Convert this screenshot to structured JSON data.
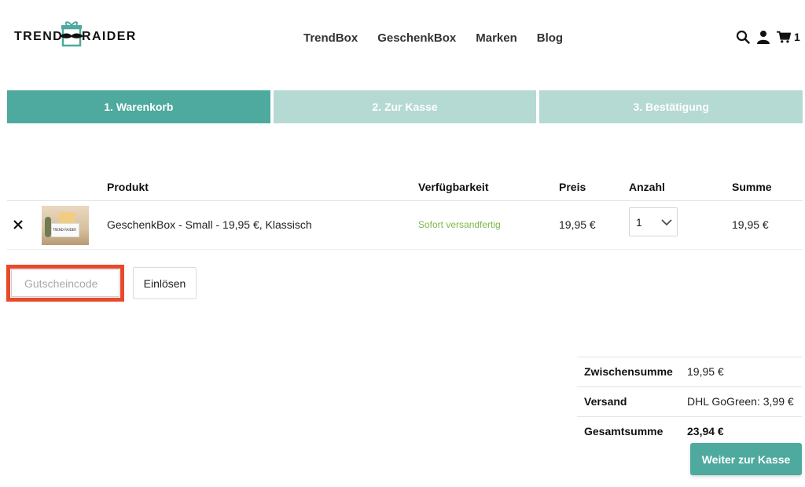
{
  "brand": {
    "left": "TREND",
    "right": "RAIDER",
    "accent": "#4ea99e"
  },
  "nav": [
    "TrendBox",
    "GeschenkBox",
    "Marken",
    "Blog"
  ],
  "header_icons": {
    "search": "search-icon",
    "account": "user-icon",
    "cart": "cart-icon",
    "cart_count": "1"
  },
  "steps": [
    "1. Warenkorb",
    "2. Zur Kasse",
    "3. Bestätigung"
  ],
  "table": {
    "headers": {
      "product": "Produkt",
      "availability": "Verfügbarkeit",
      "price": "Preis",
      "quantity": "Anzahl",
      "sum": "Summe"
    },
    "rows": [
      {
        "name": "GeschenkBox - Small - 19,95 €, Klassisch",
        "availability": "Sofort versandfertig",
        "price": "19,95 €",
        "quantity": "1",
        "sum": "19,95 €",
        "thumb_label": "TREND RAIDER"
      }
    ]
  },
  "coupon": {
    "placeholder": "Gutscheincode",
    "button": "Einlösen"
  },
  "totals": {
    "subtotal_label": "Zwischensumme",
    "subtotal": "19,95 €",
    "shipping_label": "Versand",
    "shipping": "DHL GoGreen: 3,99 €",
    "total_label": "Gesamtsumme",
    "total": "23,94 €"
  },
  "checkout_button": "Weiter zur Kasse"
}
